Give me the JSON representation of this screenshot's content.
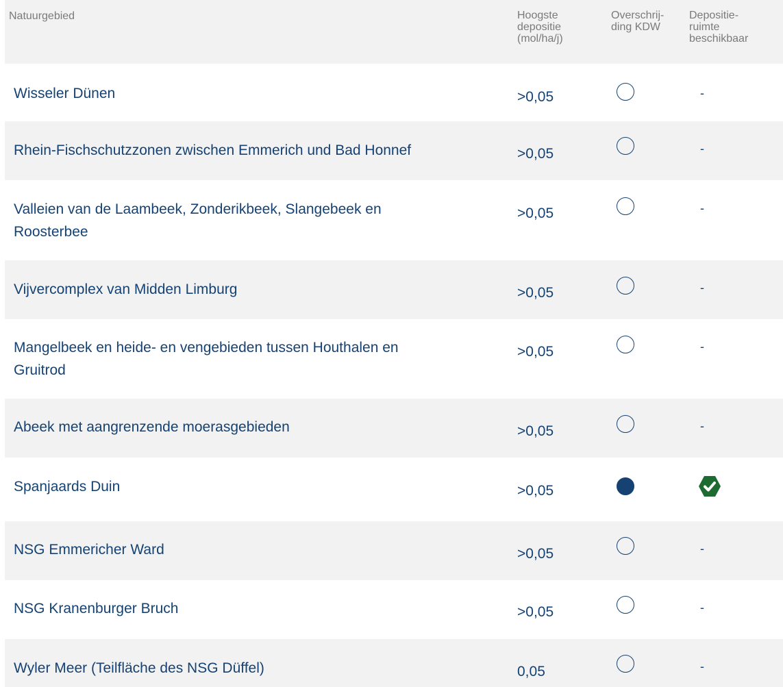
{
  "header": {
    "name_col": "Natuurgebied",
    "dep_col": [
      "Hoogste",
      "depositie",
      "(mol/ha/j)"
    ],
    "ovr_col": [
      "Overschrij-",
      "ding KDW"
    ],
    "room_col": [
      "Depositie-",
      "ruimte",
      "beschikbaar"
    ]
  },
  "colors": {
    "text_primary": "#154273",
    "header_text": "#7a7a7a",
    "stripe": "#f2f2f2",
    "check_green": "#1e6b32"
  },
  "rows": [
    {
      "name": [
        "Wisseler Dünen"
      ],
      "dep": ">0,05",
      "exceedance": false,
      "room": "-"
    },
    {
      "name": [
        "Rhein-Fischschutzzonen zwischen Emmerich und Bad Honnef"
      ],
      "dep": ">0,05",
      "exceedance": false,
      "room": "-"
    },
    {
      "name": [
        "Valleien van de Laambeek, Zonderikbeek, Slangebeek en",
        "Roosterbee"
      ],
      "dep": ">0,05",
      "exceedance": false,
      "room": "-"
    },
    {
      "name": [
        "Vijvercomplex van Midden Limburg"
      ],
      "dep": ">0,05",
      "exceedance": false,
      "room": "-"
    },
    {
      "name": [
        "Mangelbeek en heide- en vengebieden tussen Houthalen en",
        "Gruitrod"
      ],
      "dep": ">0,05",
      "exceedance": false,
      "room": "-"
    },
    {
      "name": [
        "Abeek met aangrenzende moerasgebieden"
      ],
      "dep": ">0,05",
      "exceedance": false,
      "room": "-"
    },
    {
      "name": [
        "Spanjaards Duin"
      ],
      "dep": ">0,05",
      "exceedance": true,
      "room": "check-icon"
    },
    {
      "name": [
        "NSG Emmericher Ward"
      ],
      "dep": ">0,05",
      "exceedance": false,
      "room": "-"
    },
    {
      "name": [
        "NSG Kranenburger Bruch"
      ],
      "dep": ">0,05",
      "exceedance": false,
      "room": "-"
    },
    {
      "name": [
        "Wyler Meer (Teilfläche des NSG Düffel)"
      ],
      "dep": "0,05",
      "exceedance": false,
      "room": "-"
    }
  ]
}
